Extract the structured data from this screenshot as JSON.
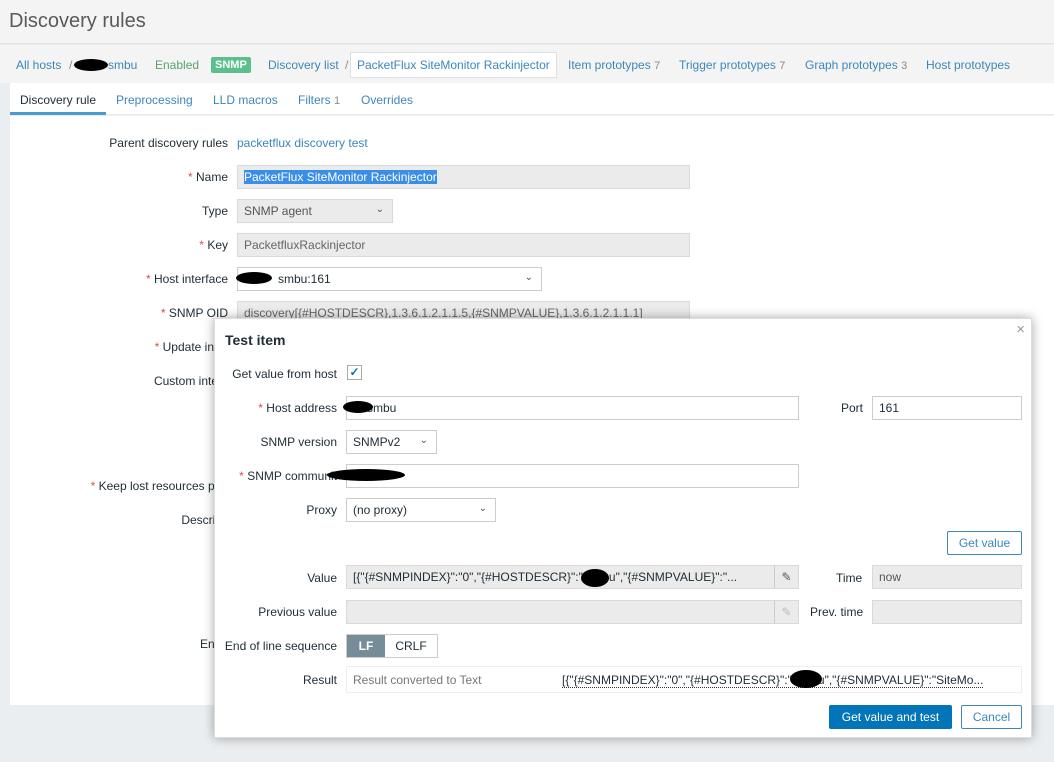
{
  "page_title": "Discovery rules",
  "breadcrumb": {
    "all_hosts": "All hosts",
    "host": "smbu",
    "status": "Enabled",
    "badge": "SNMP",
    "discovery_list": "Discovery list",
    "current": "PacketFlux SiteMonitor Rackinjector",
    "item_prototypes": "Item prototypes",
    "item_count": "7",
    "trigger_prototypes": "Trigger prototypes",
    "trigger_count": "7",
    "graph_prototypes": "Graph prototypes",
    "graph_count": "3",
    "host_prototypes": "Host prototypes"
  },
  "tabs": [
    "Discovery rule",
    "Preprocessing",
    "LLD macros",
    "Filters",
    "Overrides"
  ],
  "filters_count": "1",
  "form": {
    "parent_label": "Parent discovery rules",
    "parent_value": "packetflux discovery test",
    "name_label": "Name",
    "name_value": "PacketFlux SiteMonitor Rackinjector",
    "type_label": "Type",
    "type_value": "SNMP agent",
    "key_label": "Key",
    "key_value": "PacketfluxRackinjector",
    "interface_label": "Host interface",
    "interface_value": "smbu:161",
    "oid_label": "SNMP OID",
    "oid_value": "discovery[{#HOSTDESCR},1.3.6.1.2.1.1.5,{#SNMPVALUE},1.3.6.1.2.1.1.1]",
    "update_label": "Update inter",
    "custom_label": "Custom interv",
    "keep_label": "Keep lost resources peri",
    "desc_label": "Descripti",
    "enabled_label": "Enab"
  },
  "modal": {
    "title": "Test item",
    "close": "×",
    "get_from_host": "Get value from host",
    "checked": true,
    "host_address_label": "Host address",
    "host_address_value": "-smbu",
    "port_label": "Port",
    "port_value": "161",
    "snmp_version_label": "SNMP version",
    "snmp_version_value": "SNMPv2",
    "community_label": "SNMP communit",
    "proxy_label": "Proxy",
    "proxy_value": "(no proxy)",
    "get_value_button": "Get value",
    "value_label": "Value",
    "value_text": "[{\"{#SNMPINDEX}\":\"0\",\"{#HOSTDESCR}\":\"      smbu\",\"{#SNMPVALUE}\":\"...",
    "time_label": "Time",
    "time_value": "now",
    "prev_value_label": "Previous value",
    "prev_time_label": "Prev. time",
    "eol_label": "End of line sequence",
    "eol_options": [
      "LF",
      "CRLF"
    ],
    "eol_selected": "LF",
    "result_label": "Result",
    "result_hint": "Result converted to Text",
    "result_value": "[{\"{#SNMPINDEX}\":\"0\",\"{#HOSTDESCR}\":\"      smbu\",\"{#SNMPVALUE}\":\"SiteMo...",
    "submit_button": "Get value and test",
    "cancel_button": "Cancel"
  }
}
